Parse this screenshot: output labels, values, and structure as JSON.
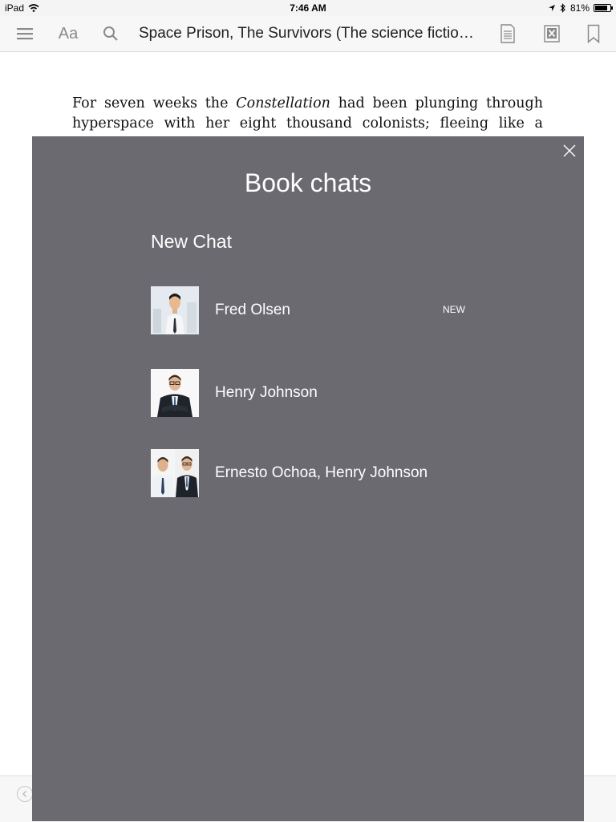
{
  "status_bar": {
    "device": "iPad",
    "time": "7:46 AM",
    "battery_percent": "81%",
    "battery_level": 0.81
  },
  "toolbar": {
    "font_settings_label": "Aa",
    "book_title": "Space Prison, The Survivors (The science fictio…"
  },
  "page": {
    "text_before": "For seven weeks the ",
    "text_italic": "Constellation",
    "text_after": " had been plunging through hyperspace with her eight thousand colonists; fleeing like a"
  },
  "chats": {
    "title": "Book chats",
    "new_chat_label": "New Chat",
    "items": [
      {
        "name": "Fred Olsen",
        "badge": "NEW"
      },
      {
        "name": "Henry Johnson",
        "badge": ""
      },
      {
        "name": "Ernesto Ochoa, Henry Johnson",
        "badge": ""
      }
    ]
  },
  "colors": {
    "overlay_bg": "#6b6a70",
    "toolbar_icon": "#8a8a8a"
  }
}
